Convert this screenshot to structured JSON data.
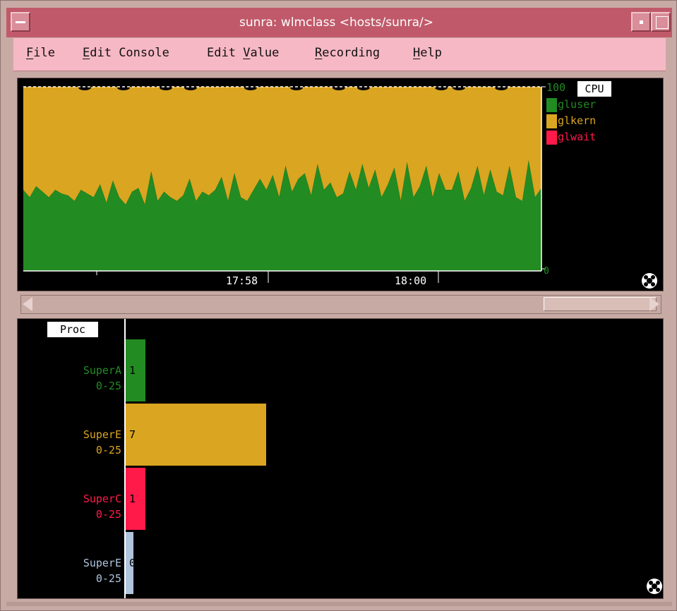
{
  "window": {
    "title": "sunra: wlmclass <hosts/sunra/>"
  },
  "menubar": {
    "items": [
      {
        "u": "F",
        "rest": "ile"
      },
      {
        "pre": "",
        "u": "E",
        "rest": "dit Console"
      },
      {
        "pre": "Edit ",
        "u": "V",
        "rest": "alue"
      },
      {
        "u": "R",
        "rest": "ecording"
      },
      {
        "u": "H",
        "rest": "elp"
      }
    ]
  },
  "cpu_chart": {
    "title": "CPU",
    "y_max_label": "100",
    "y_min_label": "0",
    "x_ticks": [
      "17:58",
      "18:00"
    ],
    "legend": [
      {
        "name": "gluser",
        "color": "#228b22"
      },
      {
        "name": "glkern",
        "color": "#daa520"
      },
      {
        "name": "glwait",
        "color": "#ff1a4a"
      }
    ]
  },
  "proc_chart": {
    "title": "Proc",
    "bars": [
      {
        "name": "SuperA",
        "range": "0-25",
        "value": "1",
        "color": "#228b22"
      },
      {
        "name": "SuperE",
        "range": "0-25",
        "value": "7",
        "color": "#daa520"
      },
      {
        "name": "SuperC",
        "range": "0-25",
        "value": "1",
        "color": "#ff1a4a"
      },
      {
        "name": "SuperE",
        "range": "0-25",
        "value": "0",
        "color": "#b0c4de"
      }
    ]
  },
  "chart_data": [
    {
      "type": "area",
      "title": "CPU",
      "xlabel": "",
      "ylabel": "",
      "ylim": [
        0,
        100
      ],
      "x_tick_labels": [
        "17:58",
        "18:00"
      ],
      "series": [
        {
          "name": "gluser",
          "color": "#228b22",
          "values": [
            44,
            40,
            46,
            43,
            40,
            44,
            42,
            41,
            38,
            44,
            42,
            40,
            47,
            37,
            49,
            40,
            36,
            43,
            45,
            36,
            54,
            38,
            43,
            40,
            38,
            41,
            50,
            38,
            43,
            41,
            44,
            51,
            38,
            53,
            40,
            38,
            44,
            50,
            44,
            52,
            40,
            57,
            43,
            50,
            53,
            41,
            58,
            44,
            48,
            40,
            42,
            54,
            44,
            58,
            45,
            55,
            40,
            47,
            56,
            38,
            59,
            40,
            46,
            57,
            40,
            53,
            44,
            44,
            54,
            38,
            45,
            57,
            41,
            55,
            43,
            41,
            57,
            40,
            38,
            60,
            40,
            45
          ]
        },
        {
          "name": "glkern",
          "color": "#daa520",
          "values": [
            56,
            60,
            54,
            57,
            60,
            56,
            58,
            59,
            62,
            56,
            58,
            60,
            53,
            63,
            51,
            60,
            64,
            57,
            55,
            64,
            46,
            62,
            57,
            60,
            62,
            59,
            50,
            62,
            57,
            59,
            56,
            49,
            62,
            47,
            60,
            62,
            56,
            50,
            56,
            48,
            60,
            43,
            57,
            50,
            47,
            59,
            42,
            56,
            52,
            60,
            58,
            46,
            56,
            42,
            55,
            45,
            60,
            53,
            44,
            62,
            41,
            60,
            54,
            43,
            60,
            47,
            56,
            56,
            46,
            62,
            55,
            43,
            59,
            45,
            57,
            59,
            43,
            60,
            62,
            40,
            60,
            55
          ]
        },
        {
          "name": "glwait",
          "color": "#ff1a4a",
          "values": [
            0
          ]
        }
      ]
    },
    {
      "type": "bar",
      "title": "Proc",
      "categories": [
        "SuperA 0-25",
        "SuperE 0-25",
        "SuperC 0-25",
        "SuperE 0-25"
      ],
      "values": [
        1,
        7,
        1,
        0
      ],
      "xlim": [
        0,
        25
      ]
    }
  ]
}
